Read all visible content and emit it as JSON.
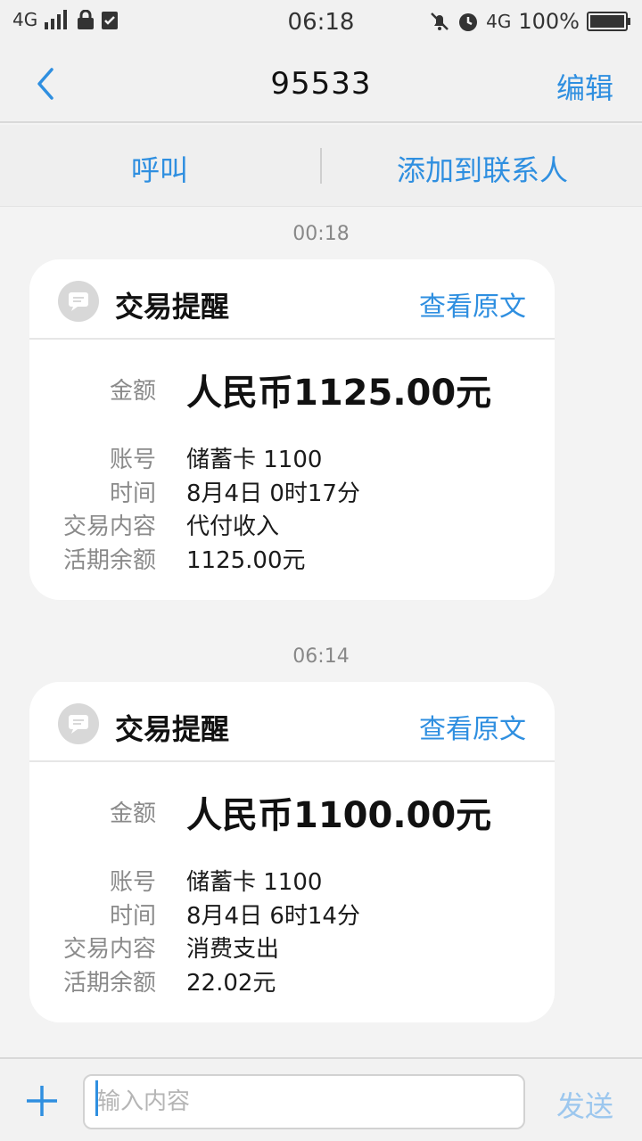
{
  "status_bar": {
    "network_left": "4G",
    "time": "06:18",
    "network_right": "4G",
    "battery": "100%"
  },
  "header": {
    "title": "95533",
    "edit_label": "编辑",
    "back_icon": "chevron-left-icon"
  },
  "actions": {
    "call_label": "呼叫",
    "add_contact_label": "添加到联系人"
  },
  "messages": [
    {
      "timestamp": "00:18",
      "title": "交易提醒",
      "view_original": "查看原文",
      "amount_label": "金额",
      "amount_value": "人民币1125.00元",
      "rows": [
        {
          "label": "账号",
          "value": "储蓄卡 1100"
        },
        {
          "label": "时间",
          "value": "8月4日 0时17分"
        },
        {
          "label": "交易内容",
          "value": "代付收入"
        },
        {
          "label": "活期余额",
          "value": "1125.00元"
        }
      ]
    },
    {
      "timestamp": "06:14",
      "title": "交易提醒",
      "view_original": "查看原文",
      "amount_label": "金额",
      "amount_value": "人民币1100.00元",
      "rows": [
        {
          "label": "账号",
          "value": "储蓄卡 1100"
        },
        {
          "label": "时间",
          "value": "8月4日 6时14分"
        },
        {
          "label": "交易内容",
          "value": "消费支出"
        },
        {
          "label": "活期余额",
          "value": "22.02元"
        }
      ]
    }
  ],
  "input_bar": {
    "placeholder": "输入内容",
    "send_label": "发送"
  },
  "colors": {
    "accent": "#2f8fe0",
    "send_disabled": "#9cc7ee",
    "background": "#f3f3f3"
  }
}
